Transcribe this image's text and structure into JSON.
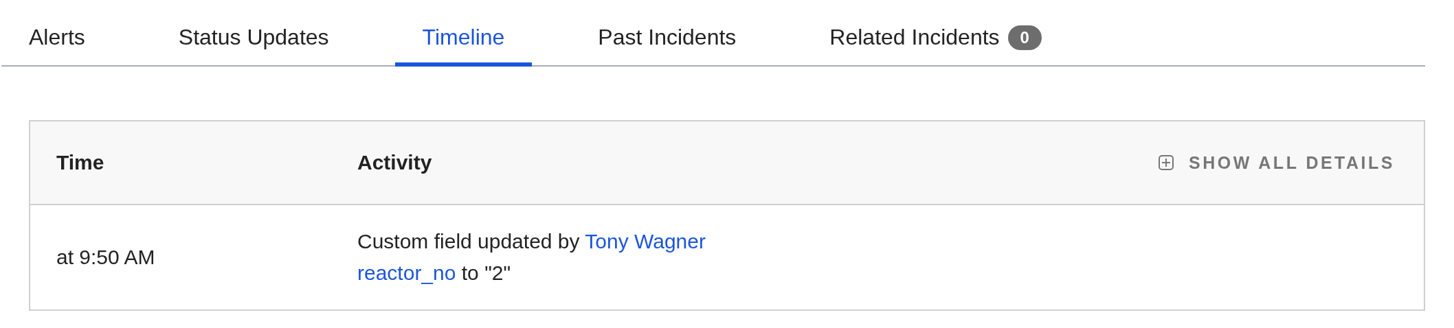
{
  "tabs": [
    {
      "label": "Alerts",
      "selected": false
    },
    {
      "label": "Status Updates",
      "selected": false
    },
    {
      "label": "Timeline",
      "selected": true
    },
    {
      "label": "Past Incidents",
      "selected": false
    },
    {
      "label": "Related Incidents",
      "selected": false,
      "count": "0"
    }
  ],
  "table": {
    "columns": [
      "Time",
      "Activity"
    ],
    "action": "SHOW ALL DETAILS",
    "rows": [
      {
        "time": "at 9:50 AM",
        "activity": {
          "text": "Custom field updated by",
          "user": "Tony Wagner",
          "field": "reactor_no",
          "change": "to \"2\""
        }
      }
    ]
  }
}
